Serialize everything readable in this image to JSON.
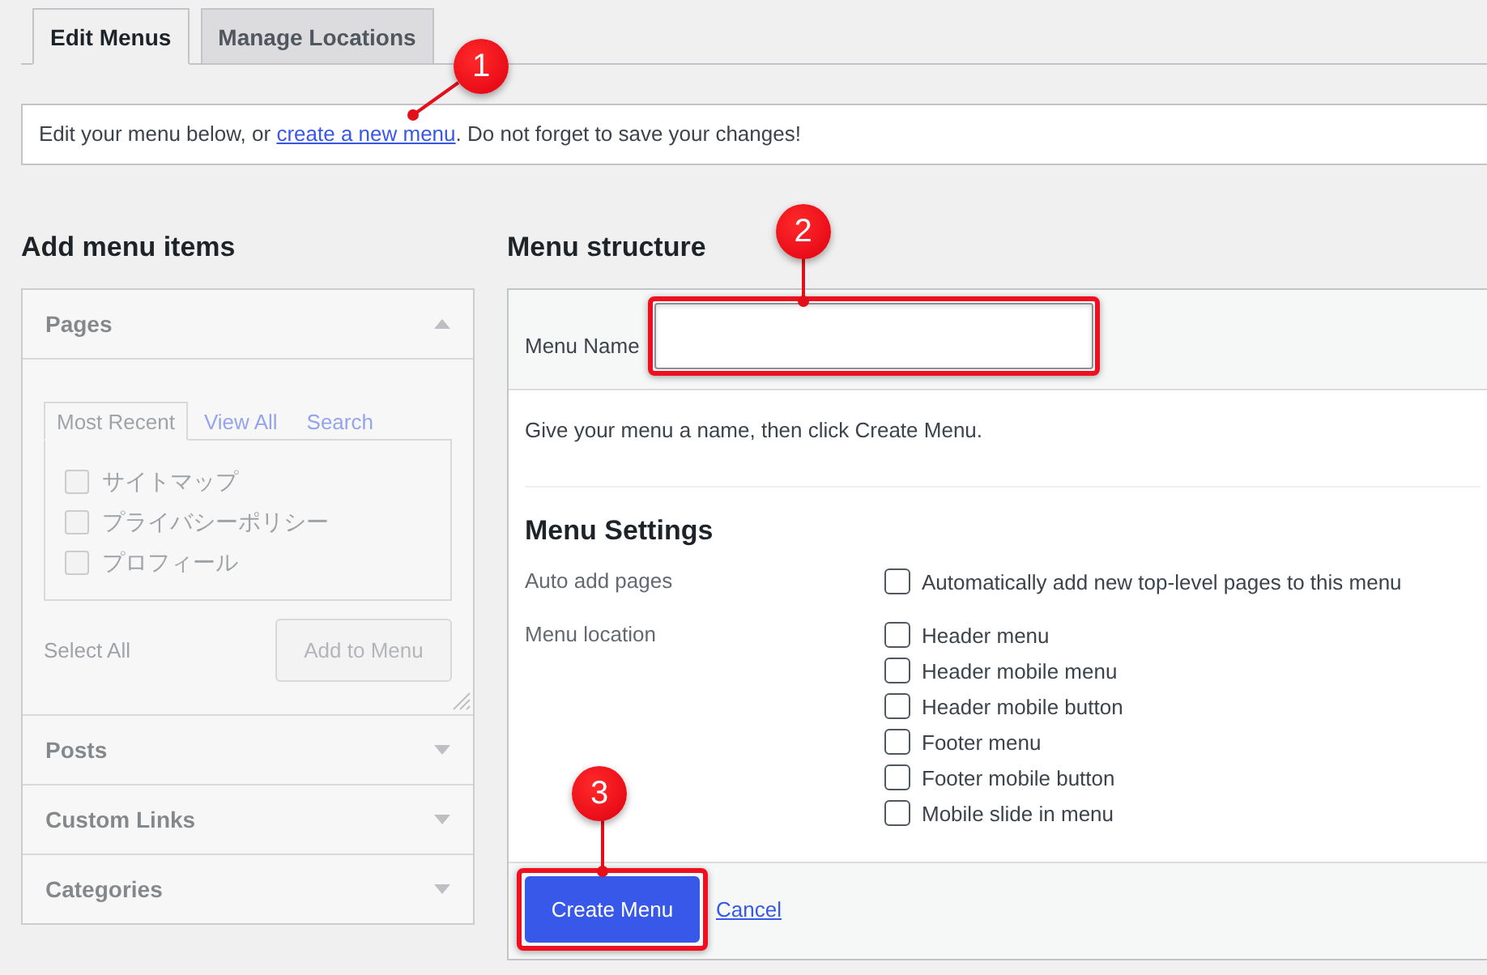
{
  "tabs": [
    {
      "label": "Edit Menus",
      "selected": true
    },
    {
      "label": "Manage Locations",
      "selected": false
    }
  ],
  "notice": {
    "before": "Edit your menu below, or ",
    "link": "create a new menu",
    "after": ". Do not forget to save your changes!",
    "callout": "1"
  },
  "add_items": {
    "title": "Add menu items",
    "disabled": true,
    "sections": [
      {
        "label": "Pages",
        "expanded": true,
        "tabs": [
          {
            "label": "Most Recent",
            "selected": true
          },
          {
            "label": "View All",
            "selected": false
          },
          {
            "label": "Search",
            "selected": false
          }
        ],
        "items": [
          {
            "label": "サイトマップ",
            "checked": false
          },
          {
            "label": "プライバシーポリシー",
            "checked": false
          },
          {
            "label": "プロフィール",
            "checked": false
          }
        ],
        "select_all": "Select All",
        "add_button": "Add to Menu"
      },
      {
        "label": "Posts",
        "expanded": false
      },
      {
        "label": "Custom Links",
        "expanded": false
      },
      {
        "label": "Categories",
        "expanded": false
      }
    ]
  },
  "menu_structure": {
    "title": "Menu structure",
    "name_label": "Menu Name",
    "name_field": {
      "highlighted": true,
      "callout": "2"
    },
    "hint": "Give your menu a name, then click Create Menu.",
    "settings": {
      "title": "Menu Settings",
      "groups": [
        {
          "label": "Auto add pages",
          "options": [
            {
              "label": "Automatically add new top-level pages to this menu",
              "checked": false
            }
          ]
        },
        {
          "label": "Menu location",
          "options": [
            {
              "label": "Header menu",
              "checked": false
            },
            {
              "label": "Header mobile menu",
              "checked": false
            },
            {
              "label": "Header mobile button",
              "checked": false
            },
            {
              "label": "Footer menu",
              "checked": false
            },
            {
              "label": "Footer mobile button",
              "checked": false
            },
            {
              "label": "Mobile slide in menu",
              "checked": false
            }
          ]
        }
      ]
    },
    "create_button": {
      "label": "Create Menu",
      "highlighted": true,
      "callout": "3"
    },
    "cancel_link": "Cancel"
  }
}
